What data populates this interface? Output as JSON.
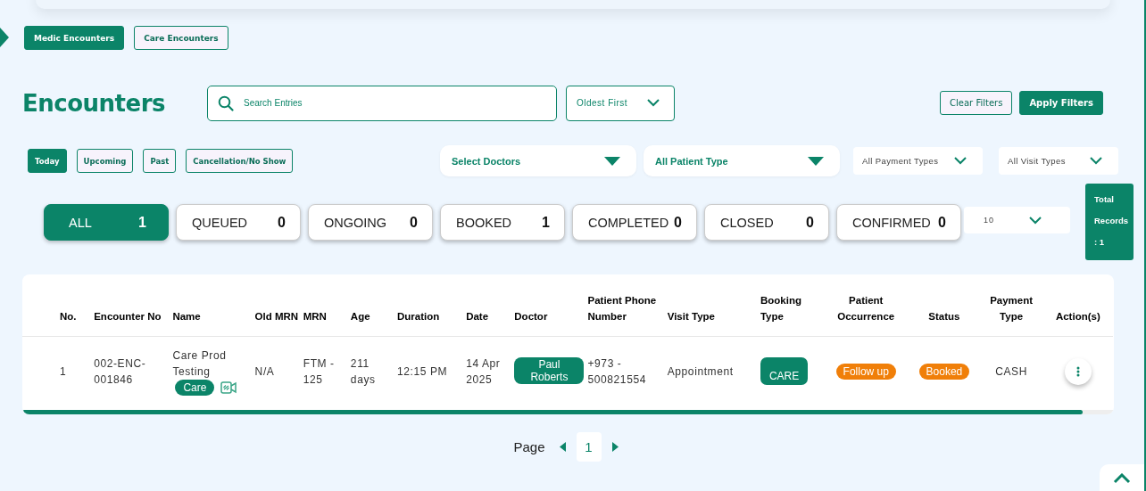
{
  "encounter_tabs": [
    {
      "label": "Medic Encounters",
      "selected": true
    },
    {
      "label": "Care Encounters",
      "selected": false
    }
  ],
  "title": "Encounters",
  "search": {
    "placeholder": "Search Entries"
  },
  "sort": {
    "value": "Oldest First"
  },
  "buttons": [
    {
      "label": "Clear Filters",
      "kind": "outline"
    },
    {
      "label": "Apply Filters",
      "kind": "solid"
    }
  ],
  "period_tabs": [
    {
      "label": "Today",
      "selected": true
    },
    {
      "label": "Upcoming",
      "selected": false
    },
    {
      "label": "Past",
      "selected": false
    },
    {
      "label": "Cancellation/No Show",
      "selected": false
    }
  ],
  "filters": [
    {
      "label": "Select Doctors",
      "kind": "bold"
    },
    {
      "label": "All Patient Type",
      "kind": "bold"
    },
    {
      "label": "All Payment Types",
      "kind": "plain"
    },
    {
      "label": "All Visit Types",
      "kind": "plain"
    }
  ],
  "status_counts": [
    {
      "label": "ALL",
      "count": "1",
      "selected": true
    },
    {
      "label": "QUEUED",
      "count": "0",
      "selected": false
    },
    {
      "label": "ONGOING",
      "count": "0",
      "selected": false
    },
    {
      "label": "BOOKED",
      "count": "1",
      "selected": false
    },
    {
      "label": "COMPLETED",
      "count": "0",
      "selected": false
    },
    {
      "label": "CLOSED",
      "count": "0",
      "selected": false
    },
    {
      "label": "CONFIRMED",
      "count": "0",
      "selected": false
    }
  ],
  "page_size": {
    "value": "10"
  },
  "total_records": "Total Records : 1",
  "table": {
    "columns": [
      "No.",
      "Encounter No",
      "Name",
      "Old MRN",
      "MRN",
      "Age",
      "Duration",
      "Date",
      "Doctor",
      "Patient Phone Number",
      "Visit Type",
      "Booking Type",
      "Patient Occurrence",
      "Status",
      "Payment Type",
      "Action(s)"
    ],
    "rows": [
      {
        "no": "1",
        "encounter_no": "002-ENC-001846",
        "name": "Care Prod Testing",
        "name_tag": "Care",
        "old_mrn": "N/A",
        "mrn": "FTM - 125",
        "age": "211 days",
        "duration": "12:15 PM",
        "date": "14 Apr 2025",
        "doctor": "Paul Roberts",
        "phone": "+973 - 500821554",
        "visit_type": "Appointment",
        "booking_type": "CARE",
        "occurrence": "Follow up",
        "status": "Booked",
        "payment_type": "CASH"
      }
    ]
  },
  "pagination": {
    "label": "Page",
    "pages": [
      {
        "label": "1",
        "selected": true
      }
    ]
  }
}
